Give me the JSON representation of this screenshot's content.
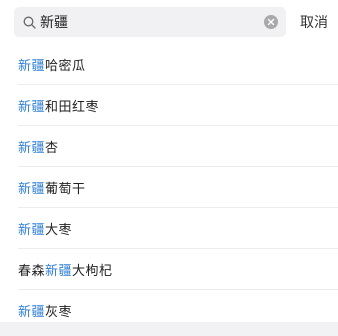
{
  "search": {
    "value": "新疆",
    "placeholder": ""
  },
  "cancel_label": "取消",
  "highlight_color": "#2f7fd6",
  "suggestions": [
    {
      "prefix": "",
      "highlight": "新疆",
      "suffix": "哈密瓜"
    },
    {
      "prefix": "",
      "highlight": "新疆",
      "suffix": "和田红枣"
    },
    {
      "prefix": "",
      "highlight": "新疆",
      "suffix": "杏"
    },
    {
      "prefix": "",
      "highlight": "新疆",
      "suffix": "葡萄干"
    },
    {
      "prefix": "",
      "highlight": "新疆",
      "suffix": "大枣"
    },
    {
      "prefix": "春森",
      "highlight": "新疆",
      "suffix": "大枸杞"
    },
    {
      "prefix": "",
      "highlight": "新疆",
      "suffix": "灰枣"
    }
  ]
}
